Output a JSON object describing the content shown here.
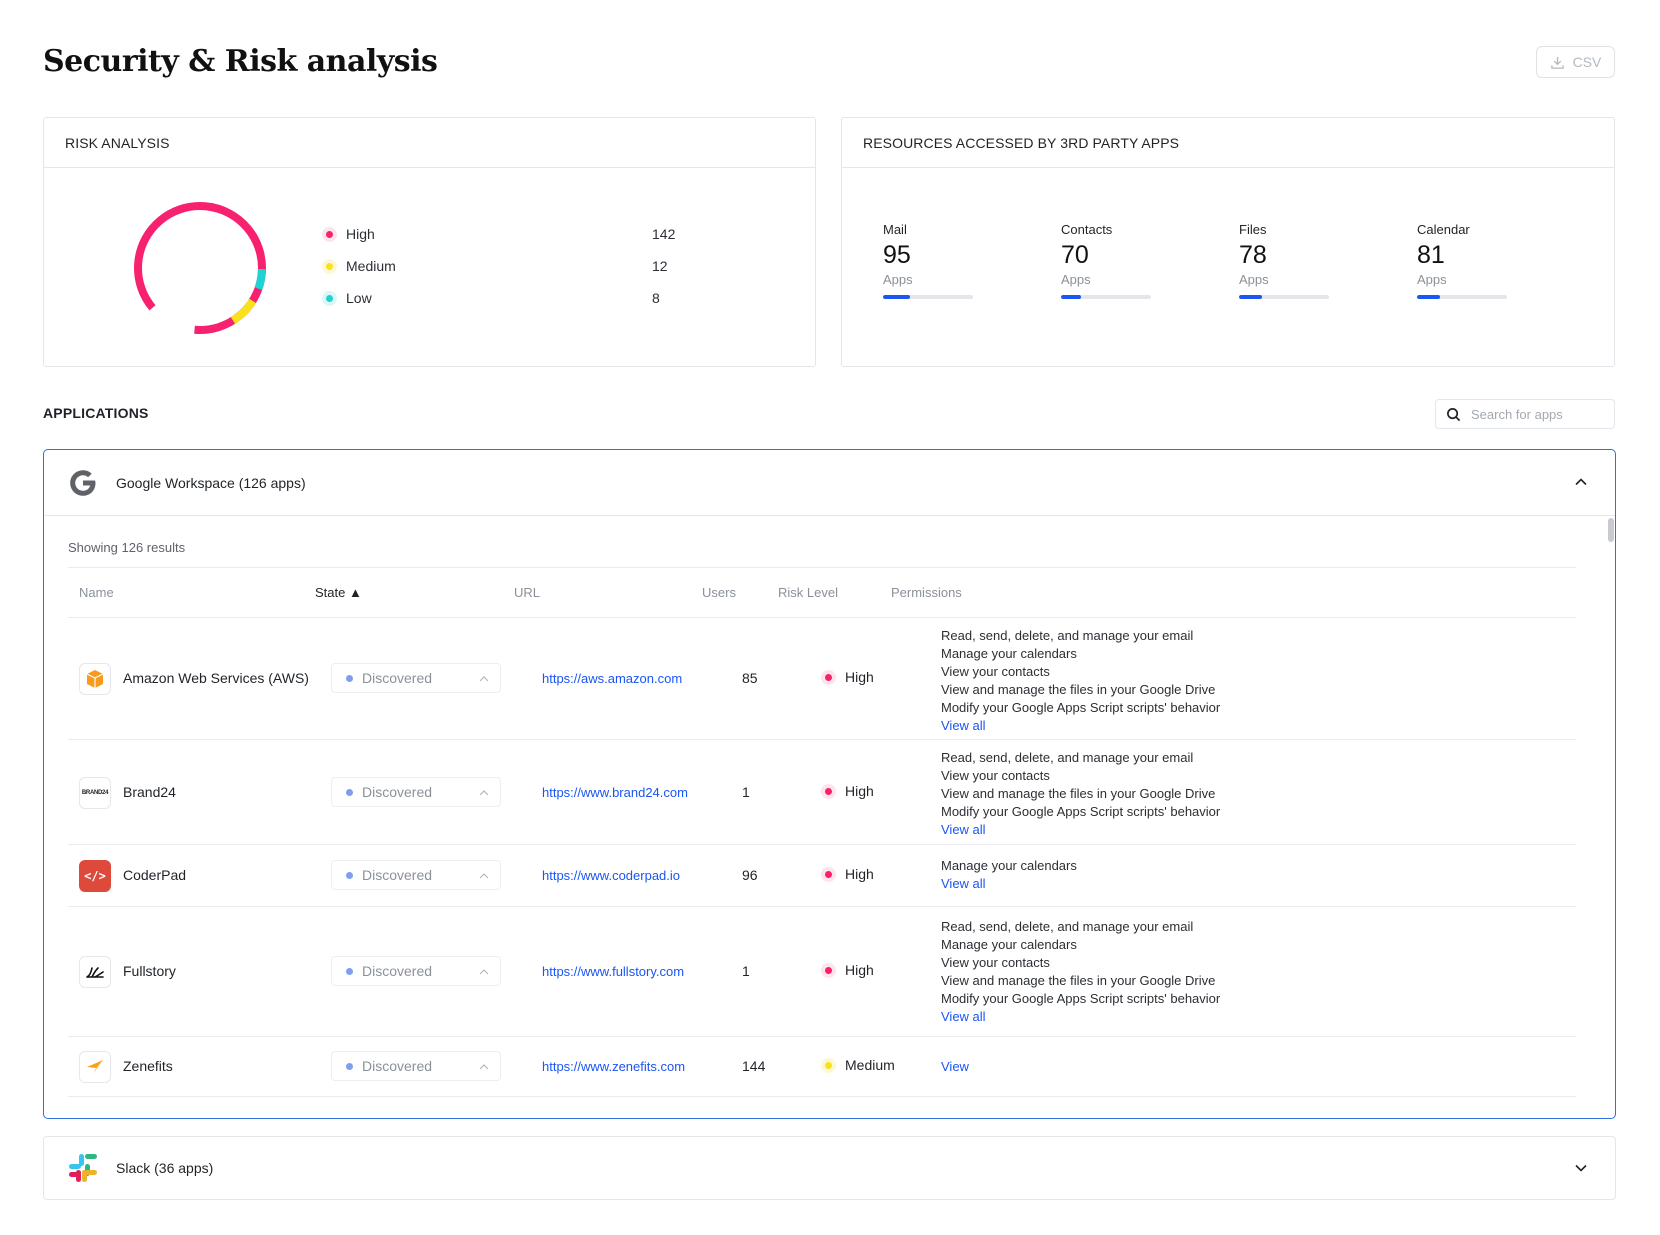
{
  "header": {
    "title": "Security & Risk analysis",
    "csv_label": "CSV"
  },
  "risk_analysis": {
    "title": "RISK ANALYSIS",
    "items": [
      {
        "label": "High",
        "value": "142",
        "color": "#f7216f"
      },
      {
        "label": "Medium",
        "value": "12",
        "color": "#f9e21b"
      },
      {
        "label": "Low",
        "value": "8",
        "color": "#1fd3d3"
      }
    ]
  },
  "resources": {
    "title": "RESOURCES ACCESSED BY 3RD PARTY APPS",
    "items": [
      {
        "label": "Mail",
        "count": "95",
        "unit": "Apps",
        "fill": 0.3
      },
      {
        "label": "Contacts",
        "count": "70",
        "unit": "Apps",
        "fill": 0.22
      },
      {
        "label": "Files",
        "count": "78",
        "unit": "Apps",
        "fill": 0.25
      },
      {
        "label": "Calendar",
        "count": "81",
        "unit": "Apps",
        "fill": 0.26
      }
    ]
  },
  "applications": {
    "title": "APPLICATIONS",
    "search_placeholder": "Search for apps"
  },
  "google_workspace": {
    "title": "Google Workspace (126 apps)",
    "results": "Showing 126 results",
    "columns": {
      "name": "Name",
      "state": "State ▲",
      "url": "URL",
      "users": "Users",
      "risk": "Risk Level",
      "permissions": "Permissions"
    },
    "rows": [
      {
        "name": "Amazon Web Services (AWS)",
        "icon": "aws-icon",
        "state": "Discovered",
        "url": "https://aws.amazon.com",
        "users": "85",
        "risk": "High",
        "permissions": [
          "Read, send, delete, and manage your email",
          "Manage your calendars",
          "View your contacts",
          "View and manage the files in your Google Drive",
          "Modify your Google Apps Script scripts' behavior"
        ],
        "link": "View all"
      },
      {
        "name": "Brand24",
        "icon": "brand24-icon",
        "icon_text": "BRAND24",
        "state": "Discovered",
        "url": "https://www.brand24.com",
        "users": "1",
        "risk": "High",
        "permissions": [
          "Read, send, delete, and manage your email",
          "View your contacts",
          "View and manage the files in your Google Drive",
          "Modify your Google Apps Script scripts' behavior"
        ],
        "link": "View all"
      },
      {
        "name": "CoderPad",
        "icon": "coderpad-icon",
        "icon_text": "</>",
        "state": "Discovered",
        "url": "https://www.coderpad.io",
        "users": "96",
        "risk": "High",
        "permissions": [
          "Manage your calendars"
        ],
        "link": "View all"
      },
      {
        "name": "Fullstory",
        "icon": "fullstory-icon",
        "state": "Discovered",
        "url": "https://www.fullstory.com",
        "users": "1",
        "risk": "High",
        "permissions": [
          "Read, send, delete, and manage your email",
          "Manage your calendars",
          "View your contacts",
          "View and manage the files in your Google Drive",
          "Modify your Google Apps Script scripts' behavior"
        ],
        "link": "View all"
      },
      {
        "name": "Zenefits",
        "icon": "zenefits-icon",
        "state": "Discovered",
        "url": "https://www.zenefits.com",
        "users": "144",
        "risk": "Medium",
        "permissions": [],
        "link": "View"
      }
    ]
  },
  "slack": {
    "title": "Slack (36 apps)"
  }
}
